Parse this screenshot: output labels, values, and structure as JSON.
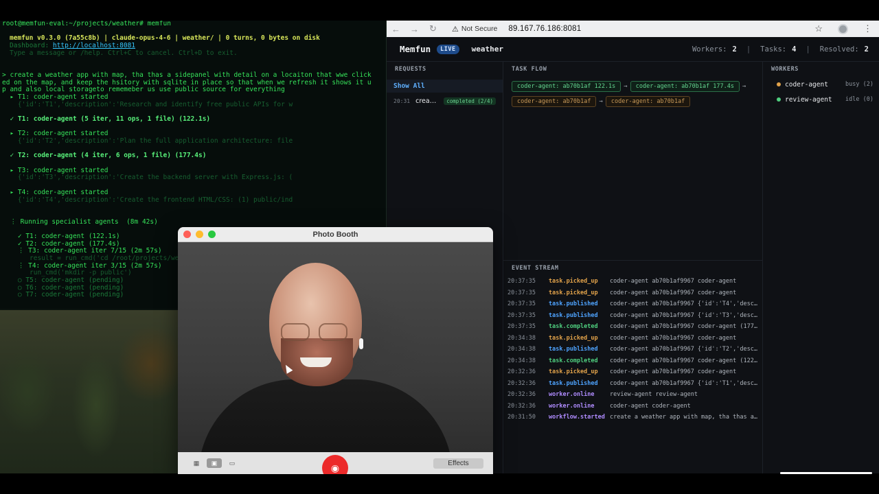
{
  "terminal": {
    "prompt": "root@memfun-eval:~/projects/weather# memfun",
    "header_line": "memfun v0.3.0 (7a55c8b) | claude-opus-4-6 | weather/ | 0 turns, 0 bytes on disk",
    "dashboard_label": "Dashboard: ",
    "dashboard_url": "http://localhost:8081",
    "hint": "Type a message or /help. Ctrl+C to cancel. Ctrl+D to exit.",
    "user_message_1": "> create a weather app with map, tha thas a sidepanel with detail on a locaiton that wwe click",
    "user_message_2": "ed on the map, and keep the hsitory with sqlite in place so that when we refresh it shows it u",
    "user_message_3": "p and also local storageto rememeber us use public source for everything",
    "lines": [
      "  ▸ T1: coder-agent started",
      "    {'id':'T1','description':'Research and identify free public APIs for w",
      "",
      "  ✓ T1: coder-agent (5 iter, 11 ops, 1 file) (122.1s)",
      "",
      "  ▸ T2: coder-agent started",
      "    {'id':'T2','description':'Plan the full application architecture: file",
      "",
      "  ✓ T2: coder-agent (4 iter, 6 ops, 1 file) (177.4s)",
      "",
      "  ▸ T3: coder-agent started",
      "    {'id':'T3','description':'Create the backend server with Express.js: (",
      "",
      "  ▸ T4: coder-agent started",
      "    {'id':'T4','description':'Create the frontend HTML/CSS: (1) public/ind",
      "",
      "",
      "  ⋮ Running specialist agents  (8m 42s)",
      "",
      "    ✓ T1: coder-agent (122.1s)",
      "    ✓ T2: coder-agent (177.4s)",
      "    ⋮ T3: coder-agent iter 7/15 (2m 57s)",
      "       result = run_cmd('cd /root/projects/weat",
      "    ⋮ T4: coder-agent iter 3/15 (2m 57s)",
      "       run_cmd('mkdir -p public')",
      "    ○ T5: coder-agent (pending)",
      "    ○ T6: coder-agent (pending)",
      "    ○ T7: coder-agent (pending)"
    ]
  },
  "browser": {
    "not_secure": "Not Secure",
    "url": "89.167.76.186:8081"
  },
  "app": {
    "brand": "Memfun",
    "live_badge": "LIVE",
    "project": "weather",
    "stats": {
      "workers_label": "Workers:",
      "workers_value": "2",
      "tasks_label": "Tasks:",
      "tasks_value": "4",
      "resolved_label": "Resolved:",
      "resolved_value": "2"
    },
    "requests": {
      "title": "REQUESTS",
      "show_all": "Show All",
      "items": [
        {
          "time": "20:31",
          "title": "create a weather app with map",
          "status": "completed (2/4)"
        }
      ]
    },
    "task_flow": {
      "title": "TASK FLOW",
      "nodes": [
        {
          "label": "coder-agent: ab70b1af 122.1s",
          "state": "done"
        },
        {
          "label": "coder-agent: ab70b1af 177.4s",
          "state": "done"
        },
        {
          "label": "coder-agent: ab70b1af",
          "state": "active"
        },
        {
          "label": "coder-agent: ab70b1af",
          "state": "active"
        }
      ]
    },
    "event_stream": {
      "title": "EVENT STREAM",
      "events": [
        {
          "time": "20:37:35",
          "type": "task.picked_up",
          "color": "#e1a24a",
          "detail": "coder-agent ab70b1af9967 coder-agent"
        },
        {
          "time": "20:37:35",
          "type": "task.picked_up",
          "color": "#e1a24a",
          "detail": "coder-agent ab70b1af9967 coder-agent"
        },
        {
          "time": "20:37:35",
          "type": "task.published",
          "color": "#4ea3ff",
          "detail": "coder-agent ab70b1af9967 {'id':'T4','desc..."
        },
        {
          "time": "20:37:35",
          "type": "task.published",
          "color": "#4ea3ff",
          "detail": "coder-agent ab70b1af9967 {'id':'T3','desc..."
        },
        {
          "time": "20:37:35",
          "type": "task.completed",
          "color": "#4fcf7f",
          "detail": "coder-agent ab70b1af9967 coder-agent (177..."
        },
        {
          "time": "20:34:38",
          "type": "task.picked_up",
          "color": "#e1a24a",
          "detail": "coder-agent ab70b1af9967 coder-agent"
        },
        {
          "time": "20:34:38",
          "type": "task.published",
          "color": "#4ea3ff",
          "detail": "coder-agent ab70b1af9967 {'id':'T2','desc..."
        },
        {
          "time": "20:34:38",
          "type": "task.completed",
          "color": "#4fcf7f",
          "detail": "coder-agent ab70b1af9967 coder-agent (122..."
        },
        {
          "time": "20:32:36",
          "type": "task.picked_up",
          "color": "#e1a24a",
          "detail": "coder-agent ab70b1af9967 coder-agent"
        },
        {
          "time": "20:32:36",
          "type": "task.published",
          "color": "#4ea3ff",
          "detail": "coder-agent ab70b1af9967 {'id':'T1','desc..."
        },
        {
          "time": "20:32:36",
          "type": "worker.online",
          "color": "#b08cff",
          "detail": "review-agent review-agent"
        },
        {
          "time": "20:32:36",
          "type": "worker.online",
          "color": "#b08cff",
          "detail": "coder-agent coder-agent"
        },
        {
          "time": "20:31:50",
          "type": "workflow.started",
          "color": "#b08cff",
          "detail": "create a weather app with map, tha thas a..."
        }
      ]
    },
    "workers": {
      "title": "WORKERS",
      "items": [
        {
          "name": "coder-agent",
          "status": "busy (2)",
          "dot_color": "#e1a24a"
        },
        {
          "name": "review-agent",
          "status": "idle (0)",
          "dot_color": "#4fcf7f"
        }
      ]
    }
  },
  "photo_booth": {
    "title": "Photo Booth",
    "effects": "Effects"
  }
}
